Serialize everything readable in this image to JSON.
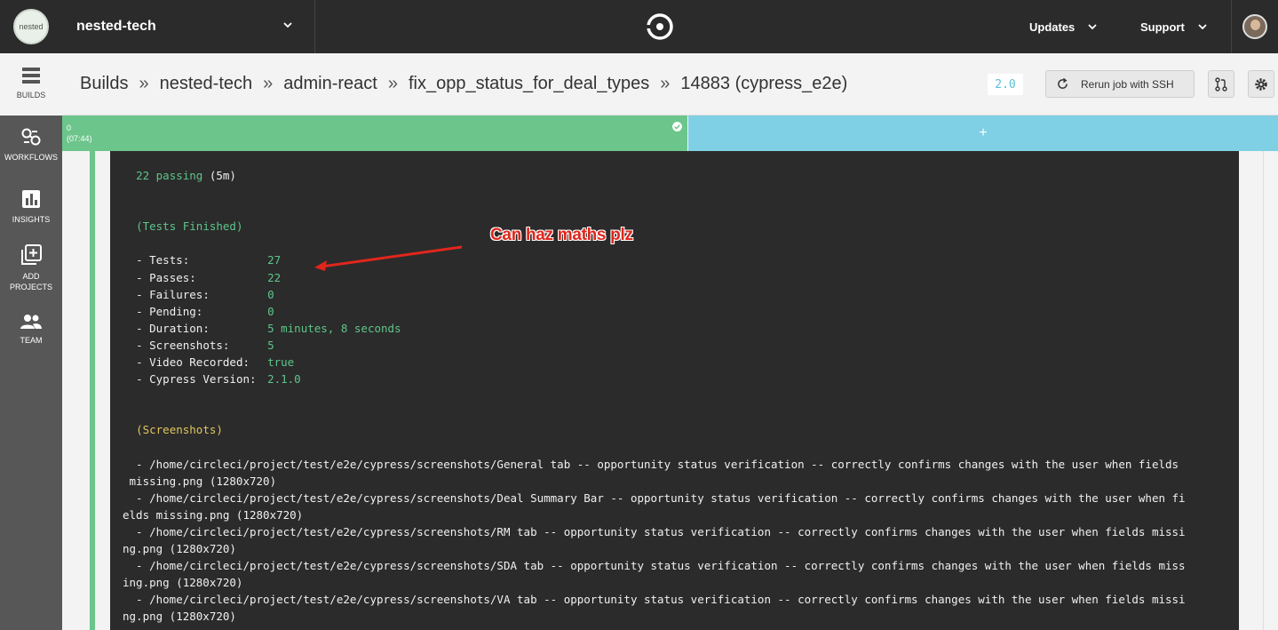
{
  "topbar": {
    "org_logo_text": "nested",
    "org_name": "nested-tech",
    "nav_updates": "Updates",
    "nav_support": "Support"
  },
  "sidebar": {
    "items": [
      {
        "label": "BUILDS",
        "icon": "builds-icon"
      },
      {
        "label": "WORKFLOWS",
        "icon": "workflows-icon"
      },
      {
        "label": "INSIGHTS",
        "icon": "insights-icon"
      },
      {
        "label": "ADD PROJECTS",
        "icon": "add-projects-icon"
      },
      {
        "label": "TEAM",
        "icon": "team-icon"
      }
    ]
  },
  "header": {
    "crumbs": [
      "Builds",
      "nested-tech",
      "admin-react",
      "fix_opp_status_for_deal_types",
      "14883 (cypress_e2e)"
    ],
    "separator": "»",
    "version": "2.0",
    "rerun_label": "Rerun job with SSH"
  },
  "runs": {
    "run_index": "0",
    "run_time": "(07:44)",
    "add_symbol": "+"
  },
  "terminal": {
    "passing_count": "22 passing",
    "passing_time": " (5m)",
    "tests_finished": "(Tests Finished)",
    "stats": [
      {
        "key": "- Tests:",
        "value": "27"
      },
      {
        "key": "- Passes:",
        "value": "22"
      },
      {
        "key": "- Failures:",
        "value": "0"
      },
      {
        "key": "- Pending:",
        "value": "0"
      },
      {
        "key": "- Duration:",
        "value": "5 minutes, 8 seconds"
      },
      {
        "key": "- Screenshots:",
        "value": "5"
      },
      {
        "key": "- Video Recorded:",
        "value": "true"
      },
      {
        "key": "- Cypress Version:",
        "value": "2.1.0"
      }
    ],
    "screenshots_heading": "(Screenshots)",
    "screenshot_lines": [
      "  - /home/circleci/project/test/e2e/cypress/screenshots/General tab -- opportunity status verification -- correctly confirms changes with the user when fields",
      " missing.png (1280x720)",
      "  - /home/circleci/project/test/e2e/cypress/screenshots/Deal Summary Bar -- opportunity status verification -- correctly confirms changes with the user when fi",
      "elds missing.png (1280x720)",
      "  - /home/circleci/project/test/e2e/cypress/screenshots/RM tab -- opportunity status verification -- correctly confirms changes with the user when fields missi",
      "ng.png (1280x720)",
      "  - /home/circleci/project/test/e2e/cypress/screenshots/SDA tab -- opportunity status verification -- correctly confirms changes with the user when fields miss",
      "ing.png (1280x720)",
      "  - /home/circleci/project/test/e2e/cypress/screenshots/VA tab -- opportunity status verification -- correctly confirms changes with the user when fields missi",
      "ng.png (1280x720)"
    ]
  },
  "annotation": {
    "text": "Can haz maths plz"
  }
}
